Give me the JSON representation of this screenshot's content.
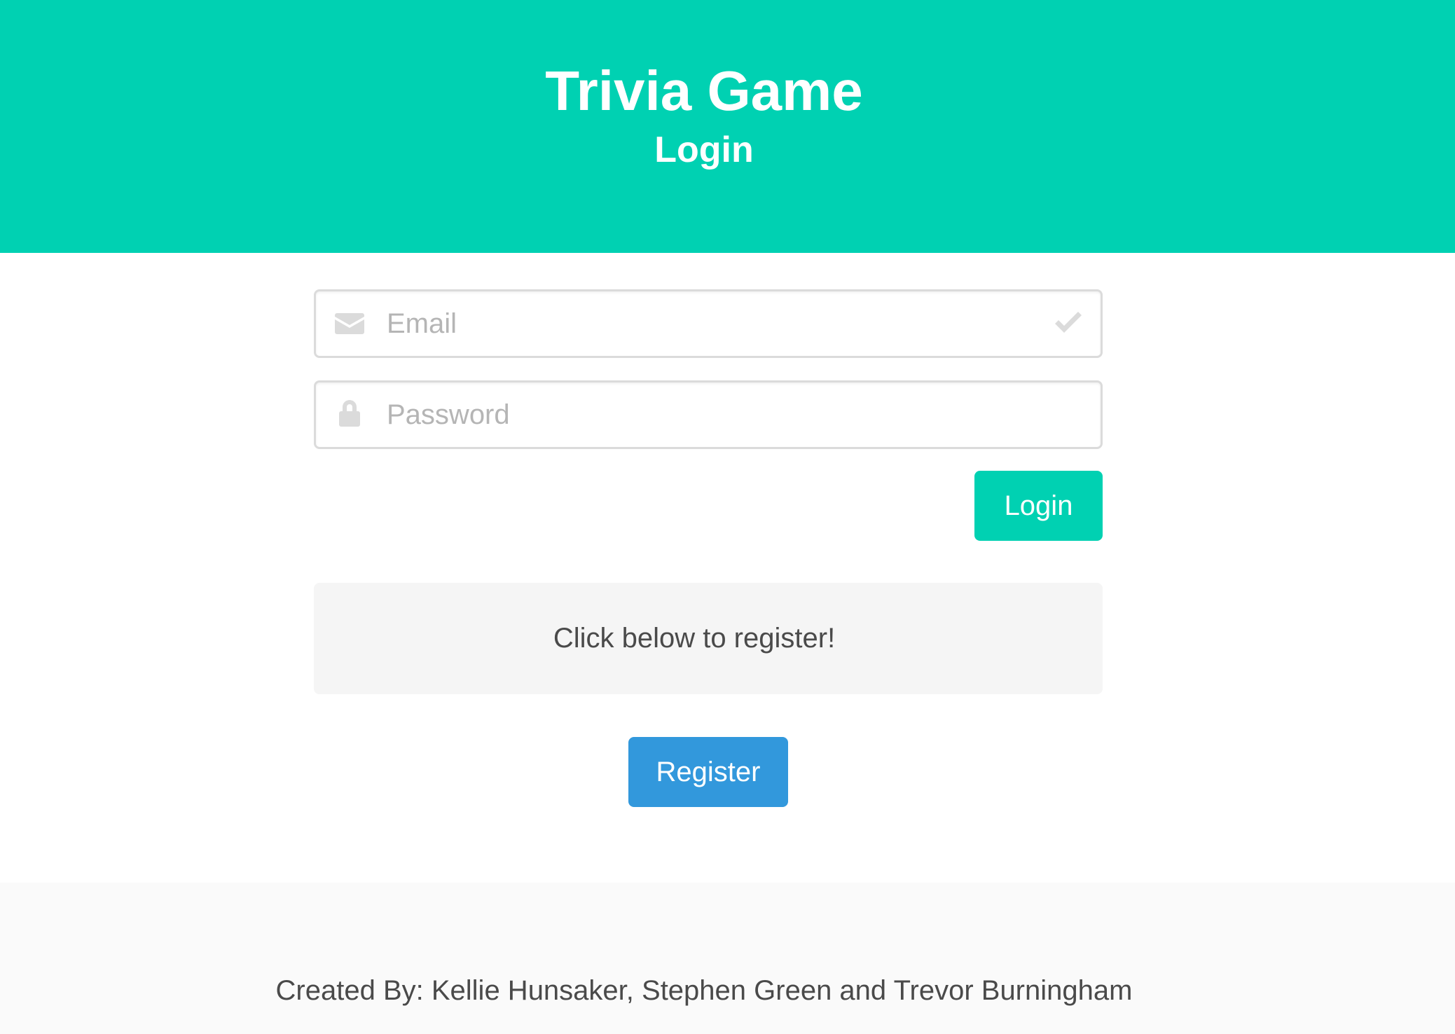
{
  "header": {
    "title": "Trivia Game",
    "subtitle": "Login"
  },
  "form": {
    "email": {
      "placeholder": "Email",
      "value": "",
      "left_icon": "envelope-icon",
      "right_icon": "check-icon"
    },
    "password": {
      "placeholder": "Password",
      "value": "",
      "left_icon": "lock-icon"
    },
    "login_button_label": "Login"
  },
  "register": {
    "prompt": "Click below to register!",
    "button_label": "Register"
  },
  "footer": {
    "credits": "Created By: Kellie Hunsaker, Stephen Green and Trevor Burningham"
  },
  "colors": {
    "primary": "#00d1b2",
    "info": "#3298dc",
    "notice_background": "#f5f5f5",
    "footer_background": "#fafafa",
    "icon_gray": "#dbdbdb"
  }
}
